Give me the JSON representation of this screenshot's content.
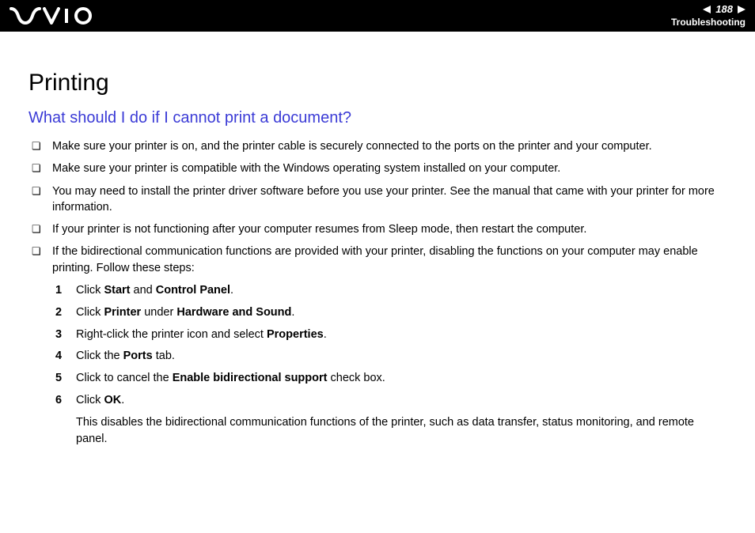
{
  "header": {
    "page_number": "188",
    "section": "Troubleshooting"
  },
  "content": {
    "title": "Printing",
    "question": "What should I do if I cannot print a document?",
    "bullets": [
      "Make sure your printer is on, and the printer cable is securely connected to the ports on the printer and your computer.",
      "Make sure your printer is compatible with the Windows operating system installed on your computer.",
      "You may need to install the printer driver software before you use your printer. See the manual that came with your printer for more information.",
      "If your printer is not functioning after your computer resumes from Sleep mode, then restart the computer.",
      "If the bidirectional communication functions are provided with your printer, disabling the functions on your computer may enable printing. Follow these steps:"
    ],
    "steps": [
      {
        "n": "1",
        "pre": "Click ",
        "b1": "Start",
        "mid": " and ",
        "b2": "Control Panel",
        "post": "."
      },
      {
        "n": "2",
        "pre": "Click ",
        "b1": "Printer",
        "mid": " under ",
        "b2": "Hardware and Sound",
        "post": "."
      },
      {
        "n": "3",
        "pre": "Right-click the printer icon and select ",
        "b1": "Properties",
        "mid": "",
        "b2": "",
        "post": "."
      },
      {
        "n": "4",
        "pre": "Click the ",
        "b1": "Ports",
        "mid": "",
        "b2": "",
        "post": " tab."
      },
      {
        "n": "5",
        "pre": "Click to cancel the ",
        "b1": "Enable bidirectional support",
        "mid": "",
        "b2": "",
        "post": " check box."
      },
      {
        "n": "6",
        "pre": "Click ",
        "b1": "OK",
        "mid": "",
        "b2": "",
        "post": "."
      }
    ],
    "trailing": "This disables the bidirectional communication functions of the printer, such as data transfer, status monitoring, and remote panel."
  }
}
